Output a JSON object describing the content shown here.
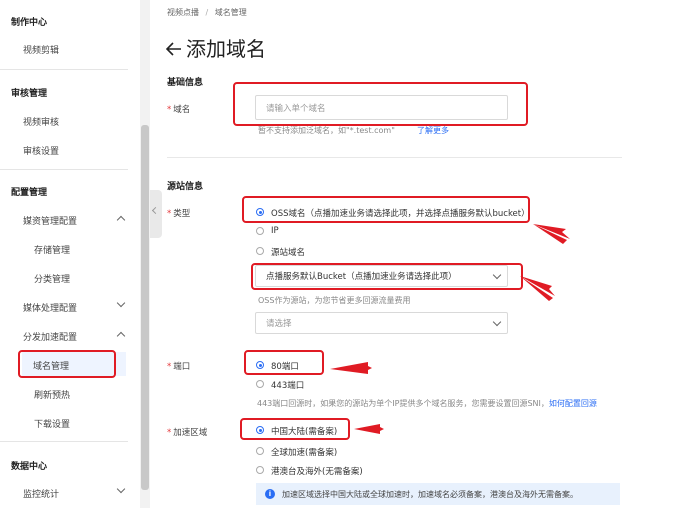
{
  "sidebar": {
    "groups": [
      {
        "label": "制作中心"
      },
      {
        "label": "审核管理"
      },
      {
        "label": "配置管理"
      },
      {
        "label": "数据中心"
      }
    ],
    "items": {
      "video_edit": "视频剪辑",
      "video_review": "视频审核",
      "review_settings": "审核设置",
      "media_config": "媒资管理配置",
      "storage": "存储管理",
      "category": "分类管理",
      "media_processing": "媒体处理配置",
      "cdn_config": "分发加速配置",
      "domain": "域名管理",
      "refresh": "刷新预热",
      "download": "下载设置",
      "monitoring": "监控统计"
    }
  },
  "breadcrumb": {
    "root": "视频点播",
    "sep": "/",
    "current": "域名管理"
  },
  "page": {
    "title": "添加域名",
    "back_icon": "arrow-left-icon"
  },
  "basic": {
    "heading": "基础信息",
    "domain_label": "域名",
    "domain_placeholder": "请输入单个域名",
    "domain_hint": "暂不支持添加泛域名，如\"*.test.com\"",
    "learn_more": "了解更多"
  },
  "origin": {
    "heading": "源站信息",
    "type_label": "类型",
    "types": [
      {
        "label": "OSS域名（点播加速业务请选择此项，并选择点播服务默认bucket）",
        "selected": true
      },
      {
        "label": "IP",
        "selected": false
      },
      {
        "label": "源站域名",
        "selected": false
      }
    ],
    "bucket_value": "点播服务默认Bucket（点播加速业务请选择此项）",
    "oss_hint": "OSS作为源站，为您节省更多回源流量费用",
    "select_placeholder": "请选择",
    "port_label": "端口",
    "ports": [
      {
        "label": "80端口",
        "selected": true
      },
      {
        "label": "443端口",
        "selected": false
      }
    ],
    "port_hint": "443端口回源时，如果您的源站为单个IP提供多个域名服务，您需要设置回源SNI，",
    "port_link": "如何配置回源",
    "region_label": "加速区域",
    "regions": [
      {
        "label": "中国大陆(需备案)",
        "selected": true
      },
      {
        "label": "全球加速(需备案)",
        "selected": false
      },
      {
        "label": "港澳台及海外(无需备案)",
        "selected": false
      }
    ],
    "region_notice": "加速区域选择中国大陆或全球加速时，加速域名必须备案，港澳台及海外无需备案。"
  },
  "colors": {
    "accent": "#2a6df4",
    "annotation": "#e01b24",
    "required": "#e4393c"
  }
}
